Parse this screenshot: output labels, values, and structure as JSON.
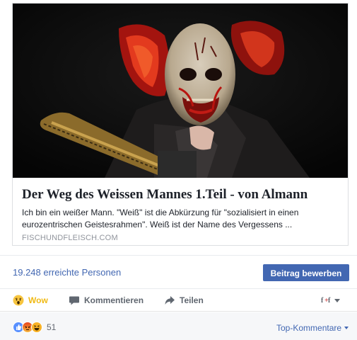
{
  "link_preview": {
    "image_alt": "Horror clown mask with red hair holding chainsaw",
    "title": "Der Weg des Weissen Mannes 1.Teil - von Almann",
    "description": "Ich bin ein weißer Mann. \"Weiß\" ist die Abkürzung für \"sozialisiert in einen eurozentrischen Geistesrahmen\". Weiß ist der Name des Vergessens ...",
    "domain": "FISCHUNDFLEISCH.COM"
  },
  "reach": {
    "text": "19.248 erreichte Personen",
    "boost_label": "Beitrag bewerben"
  },
  "actions": {
    "wow_label": "Wow",
    "comment_label": "Kommentieren",
    "share_label": "Teilen",
    "audience_icon": "page-avatar-icon"
  },
  "summary": {
    "reactions": [
      "like",
      "angry",
      "haha"
    ],
    "reaction_count": "51",
    "top_comments_label": "Top-Kommentare"
  },
  "colors": {
    "brand_blue": "#4267b2",
    "wow_yellow": "#f0ba15",
    "muted_gray": "#90949c"
  }
}
